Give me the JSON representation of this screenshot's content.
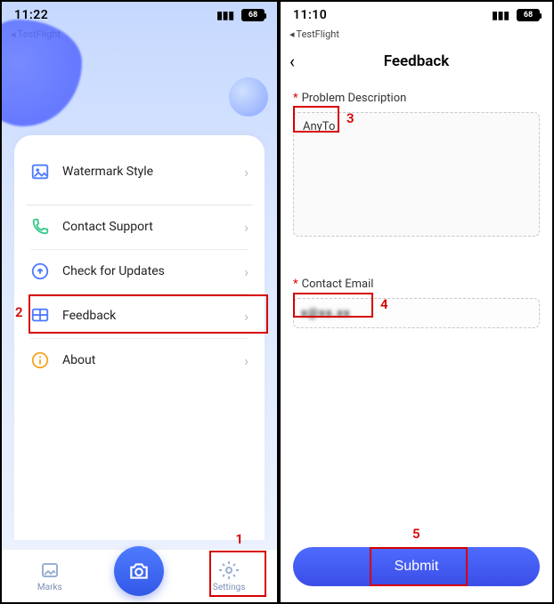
{
  "left": {
    "status": {
      "time": "11:22",
      "battery": "68"
    },
    "breadcrumb": "TestFlight",
    "menu": {
      "watermark_style": "Watermark Style",
      "contact_support": "Contact Support",
      "check_updates": "Check for Updates",
      "feedback": "Feedback",
      "about": "About"
    },
    "nav": {
      "marks": "Marks",
      "settings": "Settings"
    }
  },
  "right": {
    "status": {
      "time": "11:10",
      "battery": "68"
    },
    "breadcrumb": "TestFlight",
    "header": {
      "title": "Feedback"
    },
    "form": {
      "desc_label": "Problem Description",
      "desc_value": "AnyTo",
      "email_label": "Contact Email",
      "email_value": "x@xx.xx",
      "submit": "Submit"
    }
  },
  "annotations": {
    "n1": "1",
    "n2": "2",
    "n3": "3",
    "n4": "4",
    "n5": "5"
  }
}
